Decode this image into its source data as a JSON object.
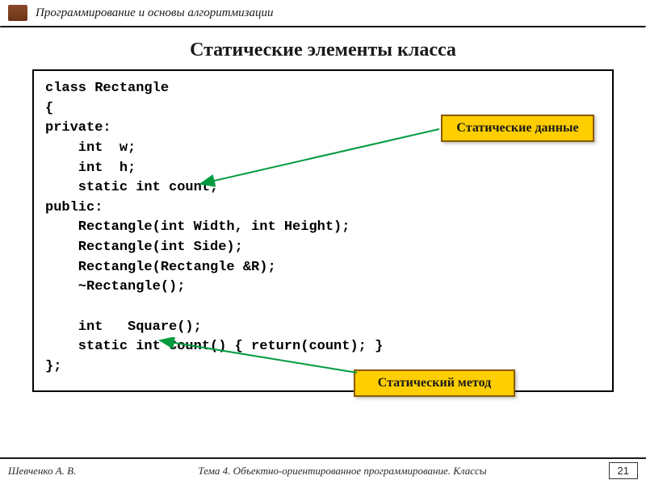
{
  "header": {
    "course_title": "Программирование и основы алгоритмизации"
  },
  "slide": {
    "title": "Статические элементы класса"
  },
  "code": {
    "lines": "class Rectangle\n{\nprivate:\n    int  w;\n    int  h;\n    static int count;\npublic:\n    Rectangle(int Width, int Height);\n    Rectangle(int Side);\n    Rectangle(Rectangle &R);\n    ~Rectangle();\n\n    int   Square();\n    static int Count() { return(count); }\n};"
  },
  "callouts": {
    "data_label": "Статические данные",
    "method_label": "Статический метод"
  },
  "footer": {
    "author": "Шевченко А. В.",
    "topic": "Тема 4. Объектно-ориентированное программирование. Классы",
    "page": "21"
  },
  "colors": {
    "callout_bg": "#ffce00",
    "callout_border": "#8a5a00",
    "arrow": "#009a3e"
  }
}
